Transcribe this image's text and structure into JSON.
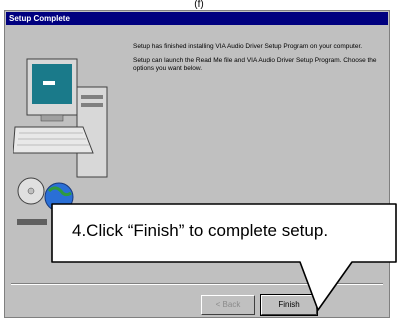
{
  "page": {
    "header_mark": "(f)"
  },
  "window": {
    "title": "Setup Complete",
    "paragraphs": [
      "Setup has finished installing VIA Audio Driver Setup Program on your computer.",
      "Setup can launch the Read Me file and VIA Audio Driver Setup Program. Choose the options you want below."
    ],
    "back_label": "< Back",
    "finish_label": "Finish"
  },
  "callout": {
    "text": "4.Click “Finish” to complete setup."
  },
  "colors": {
    "title_bar": "#00007f",
    "dialog_bg": "#c0c0c0",
    "monitor_screen": "#1a7a8a"
  }
}
